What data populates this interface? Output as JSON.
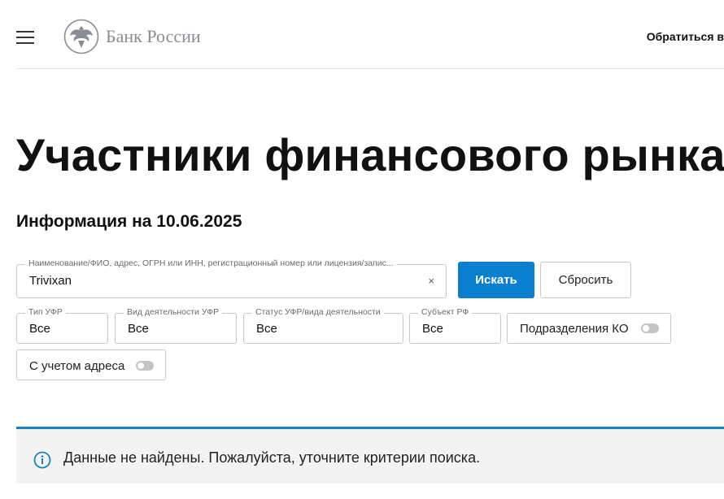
{
  "header": {
    "logo_text": "Банк России",
    "contact_link": "Обратиться в"
  },
  "page": {
    "title": "Участники финансового рынка",
    "info_date": "Информация на 10.06.2025"
  },
  "search": {
    "legend": "Наименование/ФИО, адрес, ОГРН или ИНН, регистрационный номер или лицензия/запис...",
    "value": "Trivixan",
    "clear_symbol": "×",
    "search_button": "Искать",
    "reset_button": "Сбросить"
  },
  "filters": [
    {
      "legend": "Тип УФР",
      "value": "Все"
    },
    {
      "legend": "Вид деятельности УФР",
      "value": "Все"
    },
    {
      "legend": "Статус УФР/вида деятельности",
      "value": "Все"
    },
    {
      "legend": "Субъект РФ",
      "value": "Все"
    }
  ],
  "toggles": [
    {
      "label": "Подразделения КО",
      "on": false
    },
    {
      "label": "С учетом адреса",
      "on": false
    }
  ],
  "notice": {
    "message": "Данные не найдены. Пожалуйста, уточните критерии поиска.",
    "accent_color": "#1a80c4"
  },
  "colors": {
    "primary": "#0a7fcf"
  }
}
